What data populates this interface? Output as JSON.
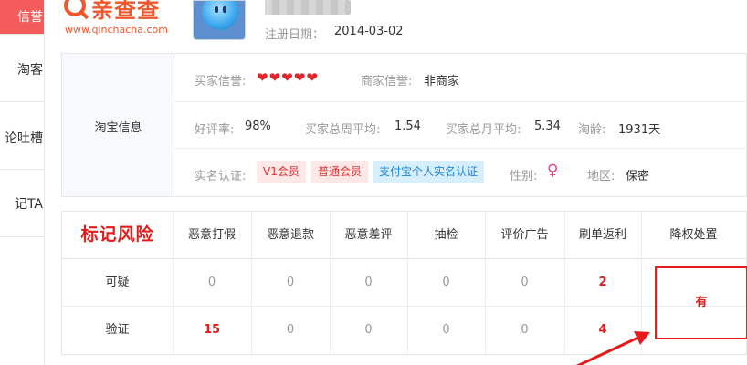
{
  "sidebar": {
    "items": [
      {
        "label": "信誉",
        "active": true
      },
      {
        "label": "淘客",
        "active": false
      },
      {
        "label": "论吐槽",
        "active": false
      },
      {
        "label": "记TA",
        "active": false
      }
    ]
  },
  "logo": {
    "name": "亲查查",
    "url": "www.qinchacha.com"
  },
  "profile": {
    "register_label": "注册日期：",
    "register_date": "2014-03-02"
  },
  "taobao_info": {
    "title": "淘宝信息",
    "buyer_credit_label": "买家信誉:",
    "buyer_credit_hearts": 5,
    "seller_credit_label": "商家信誉:",
    "seller_credit_value": "非商家",
    "good_rate_label": "好评率:",
    "good_rate_value": "98%",
    "weekly_avg_label": "买家总周平均:",
    "weekly_avg_value": "1.54",
    "monthly_avg_label": "买家总月平均:",
    "monthly_avg_value": "5.34",
    "age_label": "淘龄:",
    "age_value": "1931天",
    "realname_label": "实名认证:",
    "tags": [
      "V1会员",
      "普通会员",
      "支付宝个人实名认证"
    ],
    "gender_label": "性别:",
    "gender_icon": "♀",
    "region_label": "地区:",
    "region_value": "保密"
  },
  "risk_table": {
    "logo_text": "标记风险",
    "columns": [
      "恶意打假",
      "恶意退款",
      "恶意差评",
      "抽检",
      "评价广告",
      "刷单返利",
      "降权处置"
    ],
    "rows": [
      {
        "label": "可疑",
        "values": [
          "0",
          "0",
          "0",
          "0",
          "0",
          "2"
        ]
      },
      {
        "label": "验证",
        "values": [
          "15",
          "0",
          "0",
          "0",
          "0",
          "4"
        ]
      }
    ],
    "penalty_value": "有",
    "accent_color": "#e21c1c"
  }
}
